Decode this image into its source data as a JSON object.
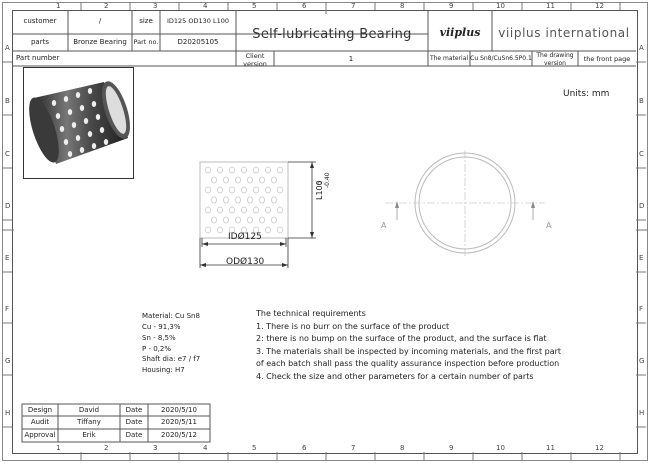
{
  "header": {
    "customer_label": "customer",
    "customer_value": "/",
    "size_label": "size",
    "size_value": "ID125 OD130 L100",
    "parts_label": "parts",
    "parts_value": "Bronze Bearing",
    "partno_label": "Part no.",
    "partno_value": "D20205105",
    "title": "Self-lubricating Bearing",
    "brand_logo": "viiplus",
    "brand_name": "viiplus international",
    "part_number_label": "Part number",
    "client_version_label": "Client version",
    "client_version_value": "1",
    "material_label": "The material",
    "material_value": "Cu Sn8/CuSn6.5P0.1",
    "drawing_version_label": "The drawing version",
    "front_page_label": "the front page"
  },
  "units": "Units: mm",
  "rulers": {
    "cols": [
      "1",
      "2",
      "3",
      "4",
      "5",
      "6",
      "7",
      "8",
      "9",
      "10",
      "11",
      "12"
    ],
    "rows": [
      "A",
      "B",
      "C",
      "D",
      "E",
      "F",
      "G",
      "H"
    ]
  },
  "dimensions": {
    "length": "L100",
    "length_tol_upper": "0",
    "length_tol_lower": "-0.40",
    "inner": "IDØ125",
    "outer": "ODØ130",
    "section_a_left": "A",
    "section_a_right": "A"
  },
  "spec": {
    "material": "Material: Cu Sn8",
    "cu": "Cu - 91,3%",
    "sn": "Sn - 8,5%",
    "p": "P - 0,2%",
    "shaft": "Shaft dia: e7 / f7",
    "housing": "Housing: H7"
  },
  "tech": {
    "title": "The technical requirements",
    "req1": "1. There is no burr on the surface of the product",
    "req2": "2: there is no bump on the surface of the product, and the surface is flat",
    "req3a": "3. The materials shall be inspected by incoming materials, and the first part",
    "req3b": "of each batch shall pass the quality assurance inspection before production",
    "req4": "4. Check the size and other parameters for a certain number of parts"
  },
  "approval": {
    "rows": [
      {
        "role": "Design",
        "name": "David",
        "date_label": "Date",
        "date": "2020/5/10"
      },
      {
        "role": "Audit",
        "name": "Tiffany",
        "date_label": "Date",
        "date": "2020/5/11"
      },
      {
        "role": "Approval",
        "name": "Erik",
        "date_label": "Date",
        "date": "2020/5/12"
      }
    ]
  }
}
